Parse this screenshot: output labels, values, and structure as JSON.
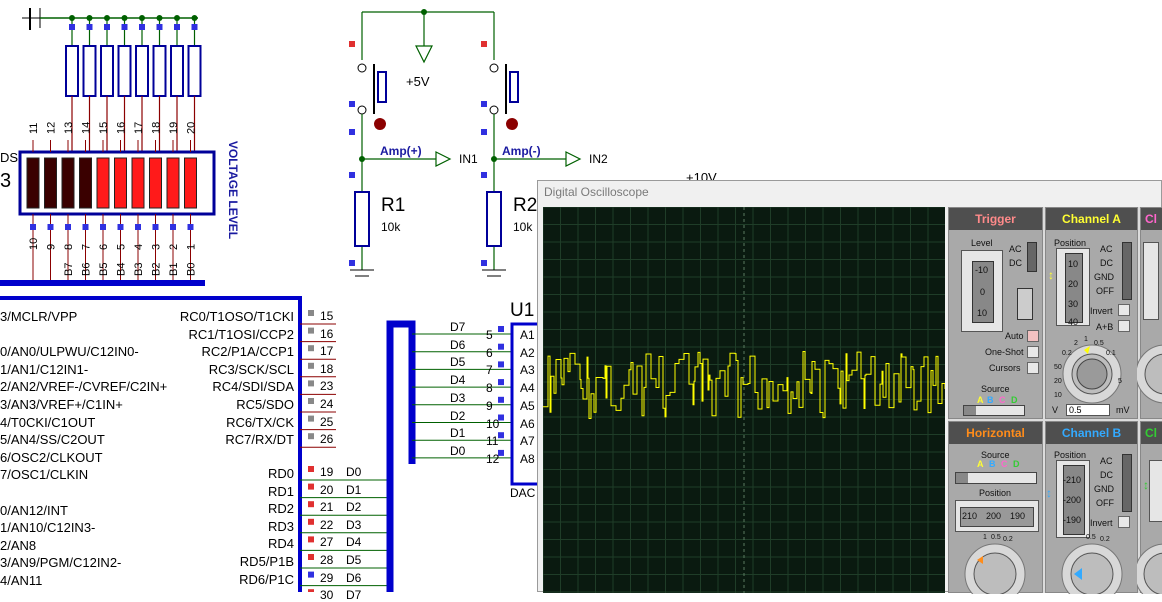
{
  "window": {
    "title": "Digital Oscilloscope"
  },
  "schematic": {
    "led_pins_top": [
      "11",
      "12",
      "13",
      "14",
      "15",
      "16",
      "17",
      "18",
      "19",
      "20"
    ],
    "led_pins_bottom": [
      "10",
      "9",
      "8",
      "7",
      "6",
      "5",
      "4",
      "3",
      "2",
      "1"
    ],
    "led_signals": [
      "B7",
      "B6",
      "B5",
      "B4",
      "B3",
      "B2",
      "B1",
      "B0"
    ],
    "led_side_fragment": "DS",
    "led_side_number": "3",
    "voltage_label": "VOLTAGE LEVEL",
    "supply_label": "+5V",
    "supply2_label": "+10V",
    "amp_plus": "Amp(+)",
    "amp_minus": "Amp(-)",
    "in1": "IN1",
    "in2": "IN2",
    "r1_name": "R1",
    "r1_value": "10k",
    "r2_name": "R2",
    "r2_value": "10k",
    "u1_name": "U1",
    "dac_label": "DAC",
    "dac_pins": [
      {
        "net": "D7",
        "num": "5",
        "pin": "A1"
      },
      {
        "net": "D6",
        "num": "6",
        "pin": "A2"
      },
      {
        "net": "D5",
        "num": "7",
        "pin": "A3"
      },
      {
        "net": "D4",
        "num": "8",
        "pin": "A4"
      },
      {
        "net": "D3",
        "num": "9",
        "pin": "A5"
      },
      {
        "net": "D2",
        "num": "10",
        "pin": "A6"
      },
      {
        "net": "D1",
        "num": "11",
        "pin": "A7"
      },
      {
        "net": "D0",
        "num": "12",
        "pin": "A8"
      }
    ],
    "mcu_left": [
      "3/MCLR/VPP",
      "0/AN0/ULPWU/C12IN0-",
      "1/AN1/C12IN1-",
      "2/AN2/VREF-/CVREF/C2IN+",
      "3/AN3/VREF+/C1IN+",
      "4/T0CKI/C1OUT",
      "5/AN4/SS/C2OUT",
      "6/OSC2/CLKOUT",
      "7/OSC1/CLKIN",
      "0/AN12/INT",
      "1/AN10/C12IN3-",
      "2/AN8",
      "3/AN9/PGM/C12IN2-",
      "4/AN11"
    ],
    "mcu_rc": [
      {
        "name": "RC0/T1OSO/T1CKI",
        "num": "15"
      },
      {
        "name": "RC1/T1OSI/CCP2",
        "num": "16"
      },
      {
        "name": "RC2/P1A/CCP1",
        "num": "17"
      },
      {
        "name": "RC3/SCK/SCL",
        "num": "18"
      },
      {
        "name": "RC4/SDI/SDA",
        "num": "23"
      },
      {
        "name": "RC5/SDO",
        "num": "24"
      },
      {
        "name": "RC6/TX/CK",
        "num": "25"
      },
      {
        "name": "RC7/RX/DT",
        "num": "26"
      }
    ],
    "mcu_rd": [
      {
        "name": "RD0",
        "num": "19",
        "net": "D0"
      },
      {
        "name": "RD1",
        "num": "20",
        "net": "D1"
      },
      {
        "name": "RD2",
        "num": "21",
        "net": "D2"
      },
      {
        "name": "RD3",
        "num": "22",
        "net": "D3"
      },
      {
        "name": "RD4",
        "num": "27",
        "net": "D4"
      },
      {
        "name": "RD5/P1B",
        "num": "28",
        "net": "D5"
      },
      {
        "name": "RD6/P1C",
        "num": "29",
        "net": "D6"
      },
      {
        "name": "",
        "num": "30",
        "net": "D7"
      }
    ]
  },
  "controls": {
    "trigger": {
      "title": "Trigger",
      "level": "Level",
      "ac": "AC",
      "dc": "DC",
      "scale": [
        "-10",
        "0",
        "10"
      ],
      "auto": "Auto",
      "one_shot": "One-Shot",
      "cursors": "Cursors",
      "source": "Source",
      "source_letters": [
        "A",
        "B",
        "C",
        "D"
      ]
    },
    "channel_a": {
      "title": "Channel A",
      "position": "Position",
      "scale": [
        "10",
        "20",
        "30",
        "40"
      ],
      "modes": [
        "AC",
        "DC",
        "GND",
        "OFF"
      ],
      "invert": "Invert",
      "aplusb": "A+B",
      "dial": [
        "2",
        "1",
        "0.5",
        "0.2",
        "0.1",
        "50",
        "20",
        "10",
        "5"
      ],
      "volts_value": "0.5",
      "v": "V",
      "mv": "mV"
    },
    "horizontal": {
      "title": "Horizontal",
      "source": "Source",
      "source_letters": [
        "A",
        "B",
        "C",
        "D"
      ],
      "position": "Position",
      "scale": [
        "210",
        "200",
        "190"
      ],
      "dial": [
        "1",
        "0.5",
        "0.2"
      ]
    },
    "channel_b": {
      "title": "Channel B",
      "position": "Position",
      "scale": [
        "-210",
        "-200",
        "-190"
      ],
      "modes": [
        "AC",
        "DC",
        "GND",
        "OFF"
      ],
      "invert": "Invert",
      "dial": [
        "0.5",
        "0.2"
      ]
    },
    "colors": {
      "trigger": "#ff8a8a",
      "channel_a": "#ffff33",
      "horizontal": "#ff8c1a",
      "channel_b": "#33aaff",
      "channel_c": "#ff66cc",
      "channel_d": "#33cc33",
      "trace": "#ffff00"
    },
    "cut_titles": {
      "c": "Cl",
      "d": "Cl"
    }
  },
  "trace_seed": 17
}
